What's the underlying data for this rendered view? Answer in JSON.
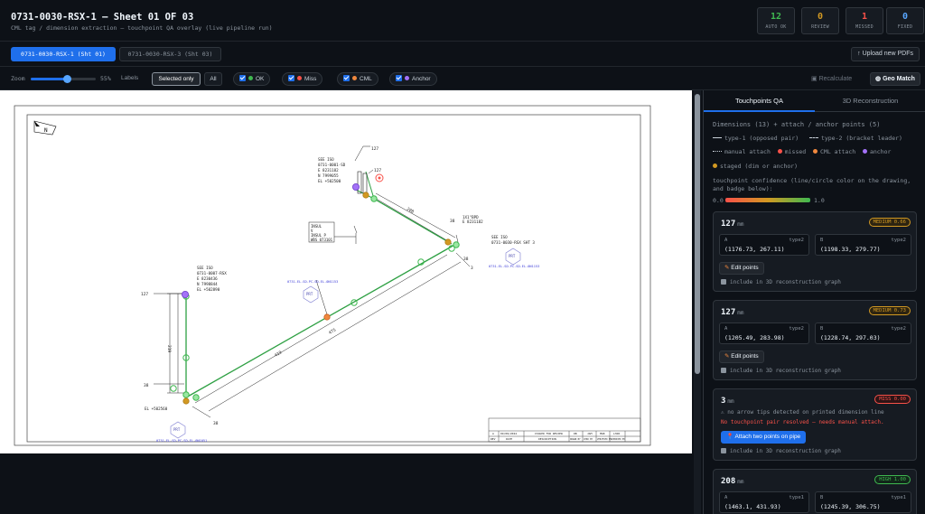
{
  "header": {
    "title": "0731-0030-RSX-1 — Sheet 01 OF 03",
    "subtitle": "CML tag / dimension extraction — touchpoint QA overlay (live pipeline run)",
    "stats": [
      {
        "value": "12",
        "label": "AUTO OK",
        "color": "#3fb950"
      },
      {
        "value": "0",
        "label": "REVIEW",
        "color": "#d29922"
      },
      {
        "value": "1",
        "label": "MISSED",
        "color": "#f85149"
      },
      {
        "value": "0",
        "label": "FIXED",
        "color": "#58a6ff"
      }
    ]
  },
  "sheet_tabs": [
    {
      "label": "0731-0030-RSX-1 (Sht 01)",
      "active": true
    },
    {
      "label": "0731-0030-RSX-3 (Sht 03)",
      "active": false
    }
  ],
  "upload_label": "↑ Upload new PDFs",
  "toolbar": {
    "zoom_label": "Zoom",
    "zoom_value": "55%",
    "zoom_fraction": 0.55,
    "labels_label": "Labels",
    "selected_only": "Selected only",
    "all": "All",
    "toggles": [
      {
        "label": "OK",
        "color": "#3fb950"
      },
      {
        "label": "Miss",
        "color": "#f85149"
      },
      {
        "label": "CML",
        "color": "#f0883e"
      },
      {
        "label": "Anchor",
        "color": "#a371f7"
      }
    ],
    "recalculate": "Recalculate",
    "geo_match": "Geo Match"
  },
  "drawing": {
    "north": "N",
    "notes": {
      "upper_iso": [
        "SEE ISO",
        "0731-0001-SD",
        "E 8231182",
        "N 7999055",
        "EL +502500"
      ],
      "right_iso": [
        "SEE ISO",
        "0731-0030-RSX SHT 3"
      ],
      "right_coord": [
        "1X1\"BPD",
        "E 8231182"
      ],
      "left_iso": [
        "SEE ISO",
        "0731-0007-RSX",
        "E 8230436",
        "N 7998844",
        "EL +502890"
      ],
      "insul": [
        "INSUL",
        "V",
        "INSUL P",
        "WBS 073101"
      ],
      "el_bottom": "EL +502560",
      "tag_mid": "0731-EL-SD-PC-SD-EL-0N1153",
      "tag_right": "0731-EL-SD-PC-SD-EL-0N1153",
      "tag_bottom": "0731-EL-SD-PC-SD-EL-0N1051"
    },
    "dims": {
      "d127a": "127",
      "d127b": "127",
      "d127c": "127",
      "d38a": "38",
      "d38b": "38",
      "d38c": "38",
      "d38d": "38",
      "d208": "208",
      "d219": "219",
      "d419": "419",
      "d475": "475",
      "d3": "3"
    },
    "title_block": {
      "row_a": [
        "A",
        "09/08/2024",
        "ISSUED FOR REVIEW",
        "DB",
        "JAM",
        "MAB",
        "LHJR"
      ],
      "headers": [
        "REV",
        "DATE",
        "DESCRIPTION",
        "DRAWN BY",
        "CHKD BY",
        "VERIFIED BY",
        "APPROVED BY"
      ]
    }
  },
  "panel": {
    "tabs": [
      "Touchpoints QA",
      "3D Reconstruction"
    ],
    "section_title": "Dimensions (13) + attach / anchor points (5)",
    "legend": {
      "type1": "type-1 (opposed pair)",
      "type2": "type-2 (bracket leader)",
      "manual": "manual attach",
      "missed": "missed",
      "cml": "CML attach",
      "anchor": "anchor",
      "staged": "staged (dim or anchor)"
    },
    "confidence_note": "touchpoint confidence (line/circle color on the drawing, and badge below):",
    "conf_min": "0.0",
    "conf_max": "1.0",
    "cards": [
      {
        "value": "127",
        "unit": "mm",
        "badge": "MEDIUM 0.66",
        "level": "med",
        "a": {
          "label": "A",
          "type": "type2",
          "coords": "(1176.73, 267.11)"
        },
        "b": {
          "label": "B",
          "type": "type2",
          "coords": "(1198.33, 279.77)"
        },
        "edit": "Edit points",
        "include": "include in 3D reconstruction graph"
      },
      {
        "value": "127",
        "unit": "mm",
        "badge": "MEDIUM 0.73",
        "level": "med",
        "a": {
          "label": "A",
          "type": "type2",
          "coords": "(1205.49, 283.98)"
        },
        "b": {
          "label": "B",
          "type": "type2",
          "coords": "(1228.74, 297.03)"
        },
        "edit": "Edit points",
        "include": "include in 3D reconstruction graph"
      },
      {
        "value": "3",
        "unit": "mm",
        "badge": "MISS 0.00",
        "level": "miss",
        "warning": "⚠ no arrow tips detected on printed dimension line",
        "error": "No touchpoint pair resolved — needs manual attach.",
        "attach": "Attach two points on pipe",
        "include": "include in 3D reconstruction graph"
      },
      {
        "value": "208",
        "unit": "mm",
        "badge": "HIGH 1.00",
        "level": "high",
        "a": {
          "label": "A",
          "type": "type1",
          "coords": "(1463.1, 431.93)"
        },
        "b": {
          "label": "B",
          "type": "type1",
          "coords": "(1245.39, 306.75)"
        }
      }
    ]
  }
}
